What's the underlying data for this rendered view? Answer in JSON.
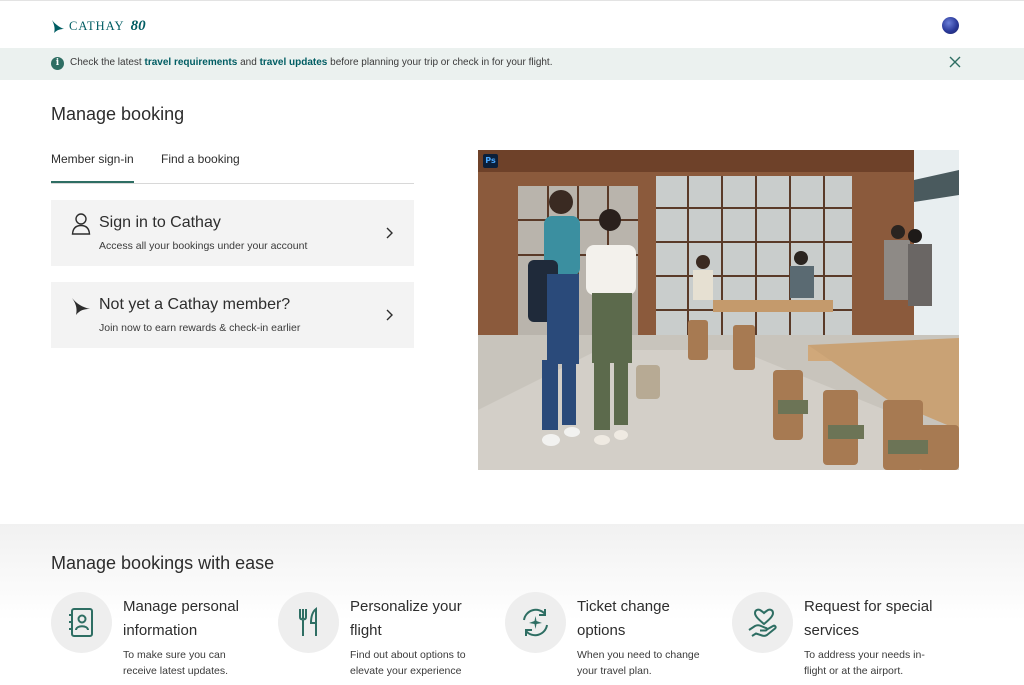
{
  "header": {
    "logo_text": "CATHAY",
    "logo_anniversary": "80"
  },
  "notice": {
    "text_1": "Check the latest ",
    "link_1": "travel requirements",
    "text_2": " and ",
    "link_2": "travel updates",
    "text_3": " before planning your trip or check in for your flight."
  },
  "page": {
    "title": "Manage booking"
  },
  "tabs": [
    {
      "label": "Member sign-in",
      "active": true
    },
    {
      "label": "Find a booking",
      "active": false
    }
  ],
  "options": [
    {
      "title": "Sign in to Cathay",
      "subtitle": "Access all your bookings under your account",
      "icon": "user-icon"
    },
    {
      "title": "Not yet a Cathay member?",
      "subtitle": "Join now to earn rewards & check-in earlier",
      "icon": "cathay-bird-icon"
    }
  ],
  "hero": {
    "badge": "Ps"
  },
  "features_section": {
    "title": "Manage bookings with ease",
    "items": [
      {
        "title": "Manage personal information",
        "desc": "To make sure you can receive latest updates.",
        "icon": "contact-book-icon"
      },
      {
        "title": "Personalize your flight",
        "desc": "Find out about options to elevate your experience",
        "icon": "cutlery-icon"
      },
      {
        "title": "Ticket change options",
        "desc": "When you need to change your travel plan.",
        "icon": "plane-cycle-icon"
      },
      {
        "title": "Request for special services",
        "desc": "To address your needs in-flight or at the airport.",
        "icon": "heart-hand-icon"
      }
    ]
  },
  "colors": {
    "brand": "#005d63",
    "accent": "#2e6e63",
    "notice_bg": "#ebf1ef",
    "card_bg": "#f3f3f3"
  }
}
